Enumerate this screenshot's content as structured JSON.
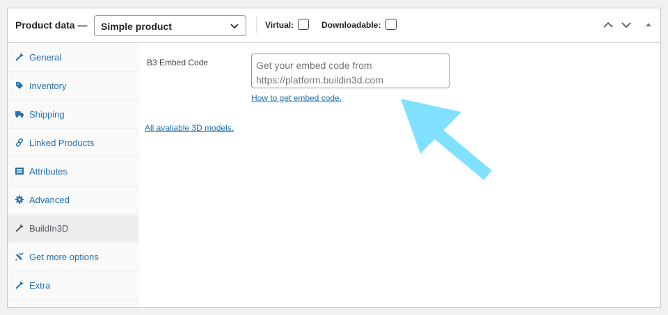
{
  "header": {
    "title": "Product data —",
    "product_type": "Simple product",
    "virtual_label": "Virtual:",
    "downloadable_label": "Downloadable:",
    "virtual_checked": false,
    "downloadable_checked": false
  },
  "tabs": [
    {
      "label": "General",
      "icon": "wrench-icon"
    },
    {
      "label": "Inventory",
      "icon": "tag-icon"
    },
    {
      "label": "Shipping",
      "icon": "truck-icon"
    },
    {
      "label": "Linked Products",
      "icon": "link-icon"
    },
    {
      "label": "Attributes",
      "icon": "list-icon"
    },
    {
      "label": "Advanced",
      "icon": "gear-icon"
    },
    {
      "label": "BuildIn3D",
      "icon": "wrench-icon",
      "active": true
    },
    {
      "label": "Get more options",
      "icon": "plugin-icon"
    },
    {
      "label": "Extra",
      "icon": "wrench-icon"
    }
  ],
  "content": {
    "field_label": "B3 Embed Code",
    "embed_placeholder": "Get your embed code from https://platform.buildin3d.com",
    "help_link": "How to get embed code.",
    "models_link": "All avaliable 3D models."
  },
  "colors": {
    "link": "#2271b1",
    "arrow": "#7fe0ff"
  }
}
